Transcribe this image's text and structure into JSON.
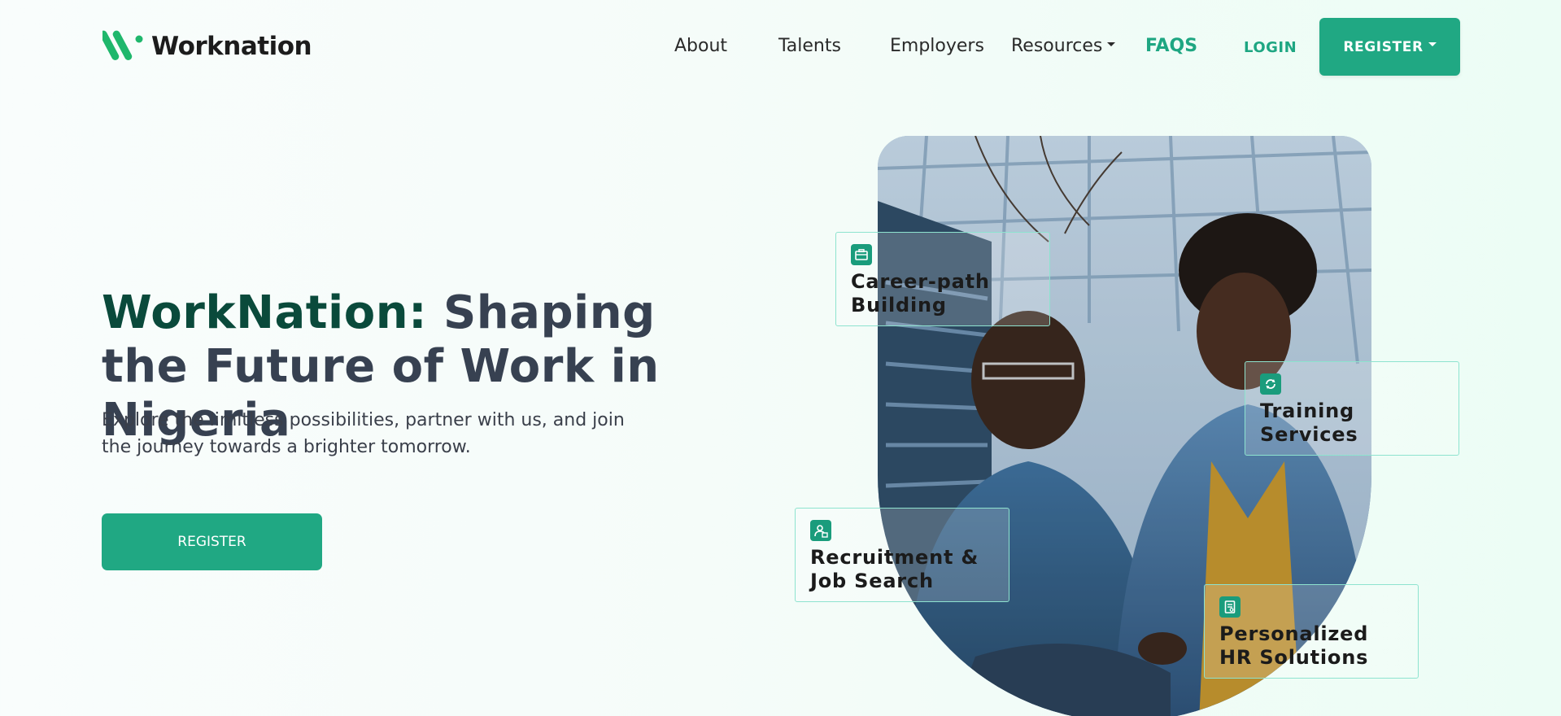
{
  "brand": {
    "name": "Worknation"
  },
  "nav": {
    "about": "About",
    "talents": "Talents",
    "employers": "Employers",
    "resources": "Resources",
    "faqs": "FAQS",
    "login": "LOGIN",
    "register": "REGISTER"
  },
  "hero": {
    "title_accent": "WorkNation:",
    "title_rest": "Shaping the Future of Work in Nigeria",
    "subtitle": "Explore the limitless possibilities, partner with us, and join the journey towards a brighter tomorrow.",
    "cta": "REGISTER"
  },
  "features": [
    {
      "title": "Career-path Building",
      "icon": "briefcase-icon"
    },
    {
      "title": "Training Services",
      "icon": "refresh-icon"
    },
    {
      "title": "Recruitment & Job Search",
      "icon": "people-search-icon"
    },
    {
      "title": "Personalized HR Solutions",
      "icon": "document-icon"
    }
  ],
  "colors": {
    "primary": "#20a883",
    "accent_dark": "#0a4a3b",
    "card_border": "#8ee3cf"
  }
}
